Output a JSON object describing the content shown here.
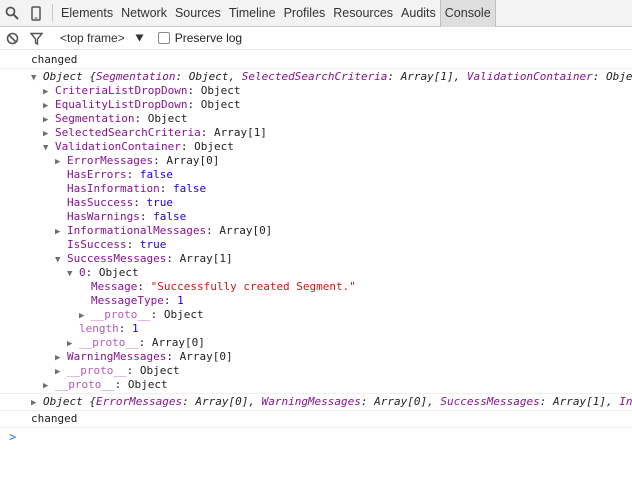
{
  "toolbar": {
    "tabs": [
      "Elements",
      "Network",
      "Sources",
      "Timeline",
      "Profiles",
      "Resources",
      "Audits",
      "Console"
    ]
  },
  "filterbar": {
    "frame": "<top frame>",
    "preserve_log": "Preserve log"
  },
  "console": {
    "msg1": "changed",
    "tree": {
      "root": {
        "label": "Object",
        "summary": [
          {
            "key": "Segmentation",
            "value": "Object"
          },
          {
            "key": "SelectedSearchCriteria",
            "value": "Array[1]"
          },
          {
            "key": "ValidationContainer",
            "value": "Objec"
          }
        ]
      },
      "l1": [
        {
          "key": "CriteriaListDropDown",
          "value": "Object"
        },
        {
          "key": "EqualityListDropDown",
          "value": "Object"
        },
        {
          "key": "Segmentation",
          "value": "Object"
        },
        {
          "key": "SelectedSearchCriteria",
          "value": "Array[1]"
        },
        {
          "key": "ValidationContainer",
          "value": "Object"
        }
      ],
      "vc": [
        {
          "key": "ErrorMessages",
          "value": "Array[0]"
        },
        {
          "key": "HasErrors",
          "value": "false"
        },
        {
          "key": "HasInformation",
          "value": "false"
        },
        {
          "key": "HasSuccess",
          "value": "true"
        },
        {
          "key": "HasWarnings",
          "value": "false"
        },
        {
          "key": "InformationalMessages",
          "value": "Array[0]"
        },
        {
          "key": "IsSuccess",
          "value": "true"
        },
        {
          "key": "SuccessMessages",
          "value": "Array[1]"
        }
      ],
      "sm": {
        "item_key": "0",
        "item_value": "Object",
        "msg_key": "Message",
        "msg_value": "\"Successfully created Segment.\"",
        "type_key": "MessageType",
        "type_value": "1",
        "proto_key": "__proto__",
        "proto_value": "Object",
        "length_key": "length",
        "length_value": "1",
        "arr_proto_key": "__proto__",
        "arr_proto_value": "Array[0]"
      },
      "vc_tail": [
        {
          "key": "WarningMessages",
          "value": "Array[0]"
        },
        {
          "key": "__proto__",
          "value": "Object"
        }
      ],
      "root_proto": {
        "key": "__proto__",
        "value": "Object"
      }
    },
    "obj2": {
      "label": "Object",
      "summary": [
        {
          "key": "ErrorMessages",
          "value": "Array[0]"
        },
        {
          "key": "WarningMessages",
          "value": "Array[0]"
        },
        {
          "key": "SuccessMessages",
          "value": "Array[1]"
        },
        {
          "key": "Inj",
          "value": ""
        }
      ]
    },
    "msg2": "changed",
    "prompt": ">"
  }
}
